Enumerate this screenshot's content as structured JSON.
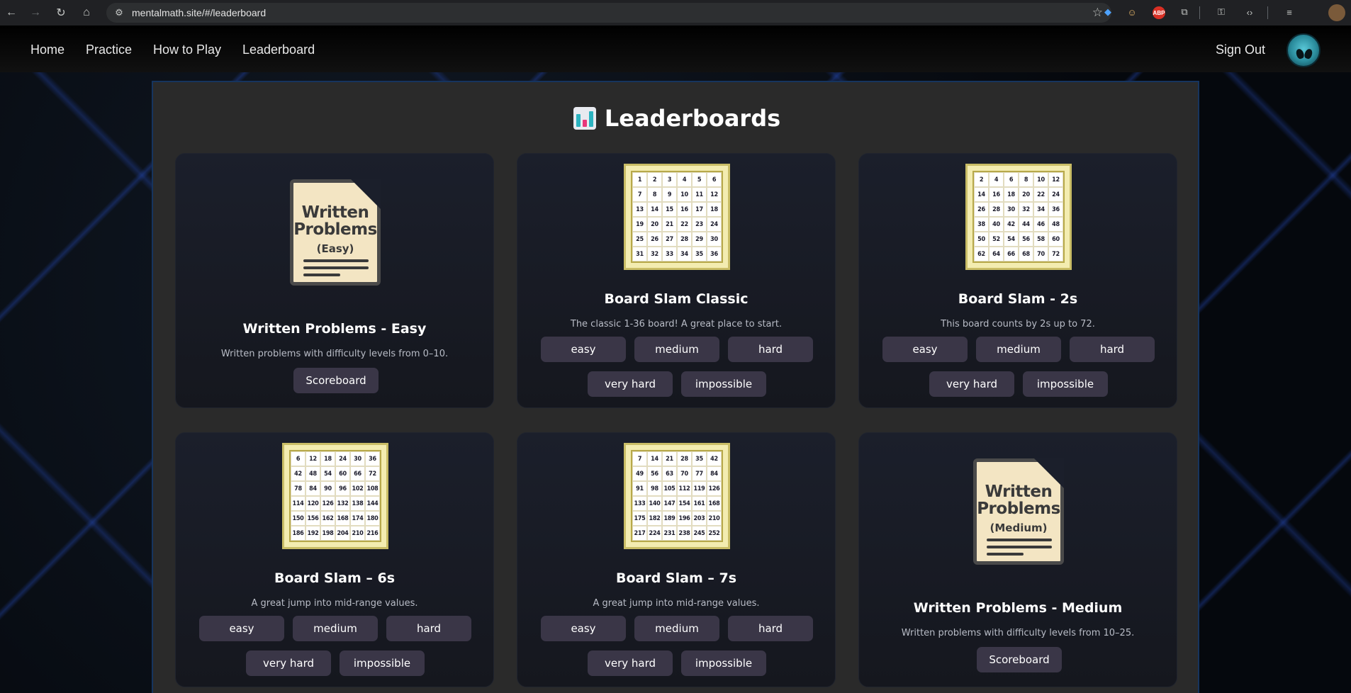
{
  "browser": {
    "url": "mentalmath.site/#/leaderboard"
  },
  "nav": {
    "links": [
      "Home",
      "Practice",
      "How to Play",
      "Leaderboard"
    ],
    "sign_out": "Sign Out"
  },
  "page": {
    "title": "Leaderboards"
  },
  "cards": [
    {
      "title": "Written Problems - Easy",
      "desc": "Written problems with difficulty levels from 0–10.",
      "button": "Scoreboard",
      "doc_title_1": "Written",
      "doc_title_2": "Problems",
      "doc_sub": "(Easy)"
    },
    {
      "title": "Board Slam Classic",
      "desc": "The classic 1-36 board! A great place to start.",
      "levels": [
        "easy",
        "medium",
        "hard",
        "very hard",
        "impossible"
      ],
      "board_start": 1,
      "board_step": 1
    },
    {
      "title": "Board Slam - 2s",
      "desc": "This board counts by 2s up to 72.",
      "levels": [
        "easy",
        "medium",
        "hard",
        "very hard",
        "impossible"
      ],
      "board_start": 2,
      "board_step": 2
    },
    {
      "title": "Board Slam – 6s",
      "desc": "A great jump into mid-range values.",
      "levels": [
        "easy",
        "medium",
        "hard",
        "very hard",
        "impossible"
      ],
      "board_start": 6,
      "board_step": 6
    },
    {
      "title": "Board Slam – 7s",
      "desc": "A great jump into mid-range values.",
      "levels": [
        "easy",
        "medium",
        "hard",
        "very hard",
        "impossible"
      ],
      "board_start": 7,
      "board_step": 7
    },
    {
      "title": "Written Problems - Medium",
      "desc": "Written problems with difficulty levels from 10–25.",
      "button": "Scoreboard",
      "doc_title_1": "Written",
      "doc_title_2": "Problems",
      "doc_sub": "(Medium)"
    }
  ],
  "colors": {
    "pill_bg": "#3a3647",
    "card_bg": "#1b1f2b",
    "panel_bg": "#2a2a2a"
  }
}
